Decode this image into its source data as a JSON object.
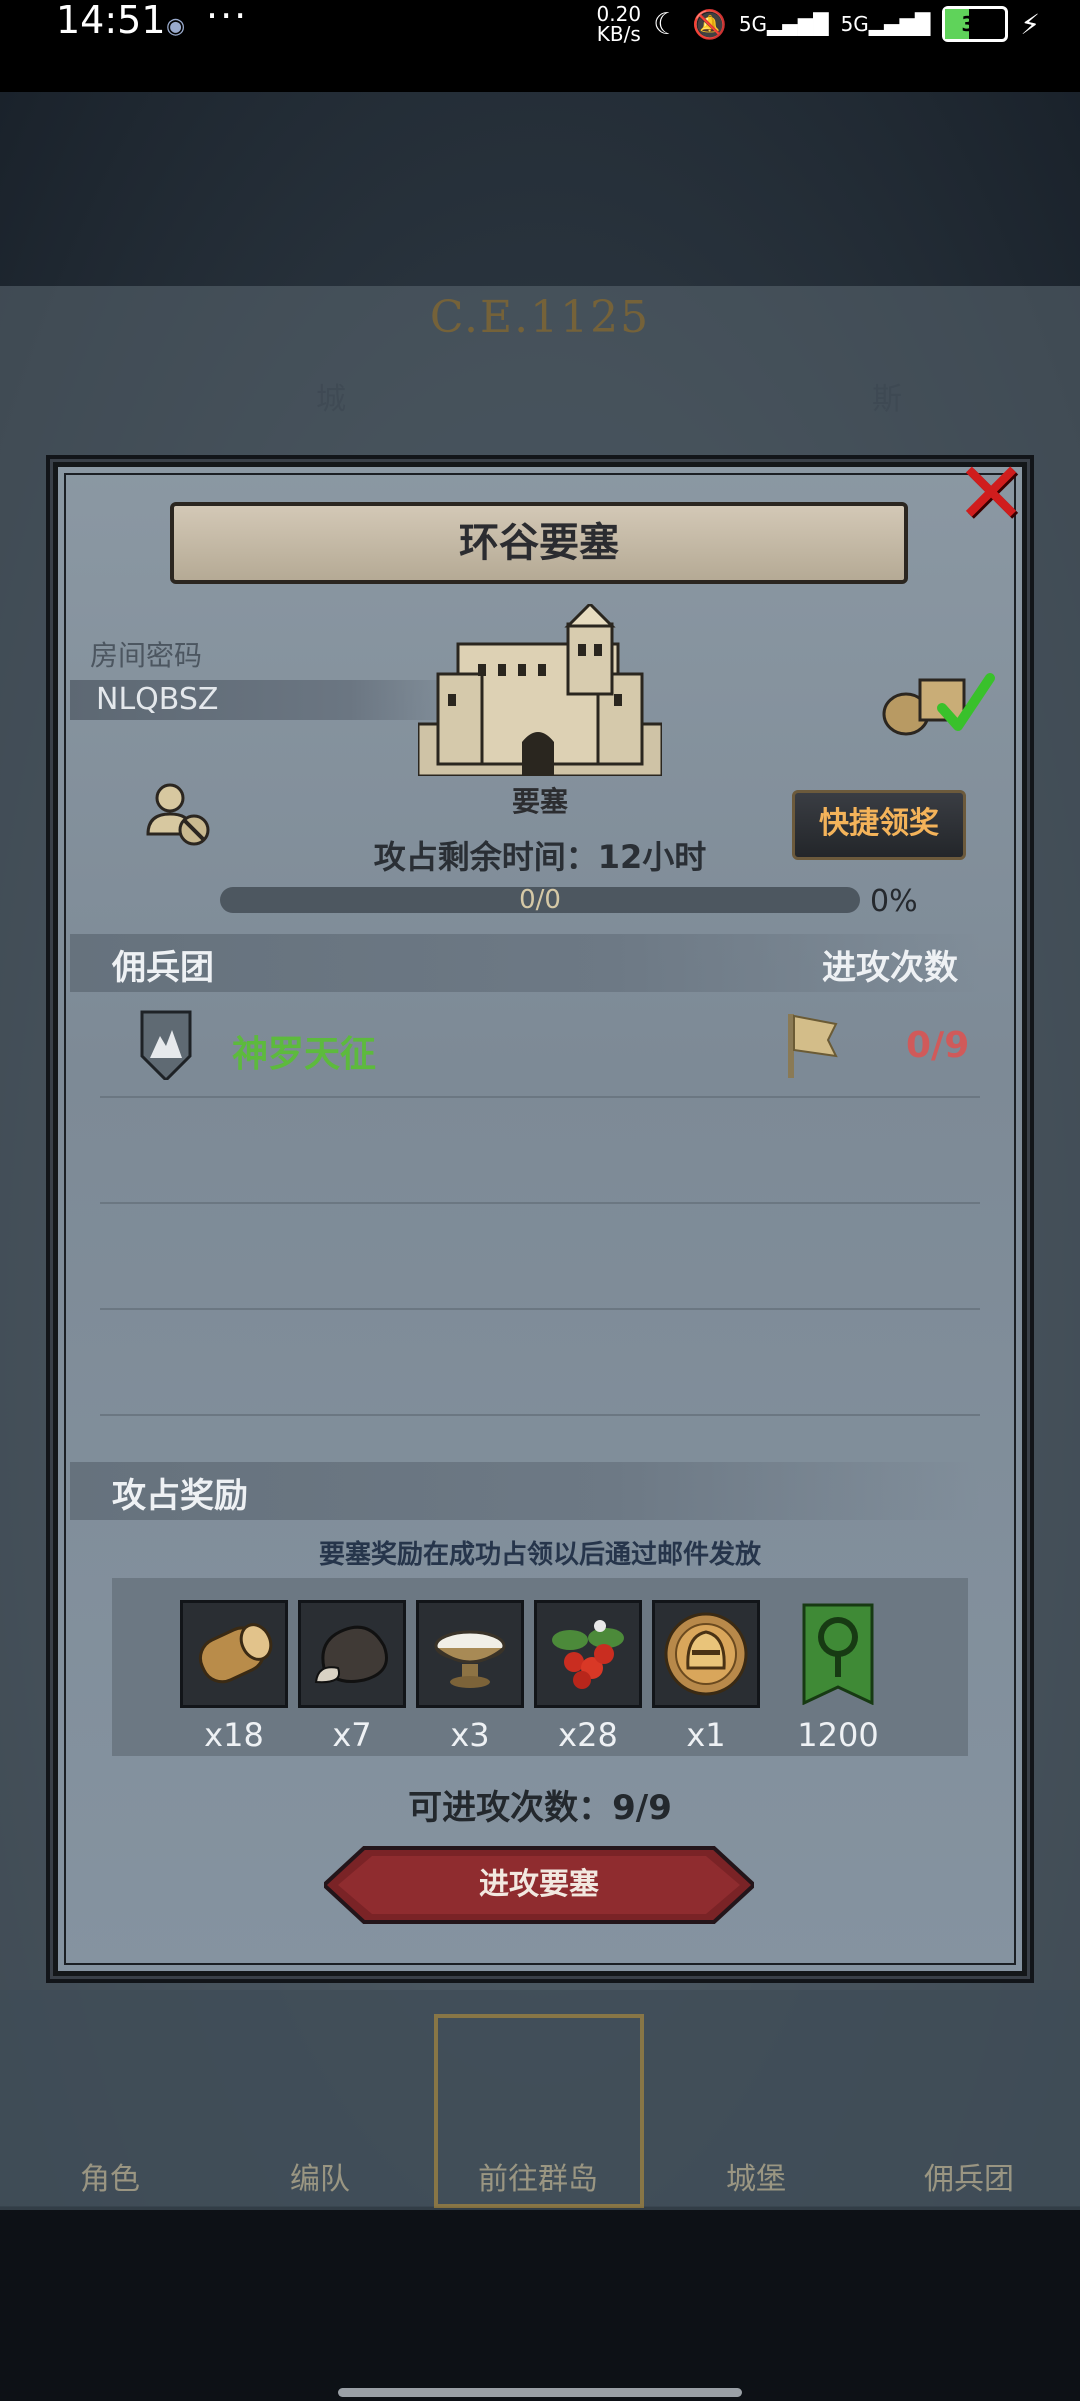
{
  "status_bar": {
    "time": "14:51",
    "network_speed_value": "0.20",
    "network_speed_unit": "KB/s",
    "battery": "39"
  },
  "background": {
    "year": "C.E.1125",
    "labels": [
      "城",
      "斯"
    ],
    "nav": [
      "角色",
      "编队",
      "前往群岛",
      "城堡",
      "佣兵团"
    ]
  },
  "modal": {
    "title": "环谷要塞",
    "room_password_label": "房间密码",
    "room_password": "NLQBSZ",
    "fort_type": "要塞",
    "remaining_time": "攻占剩余时间：12小时",
    "quick_claim": "快捷领奖",
    "progress_text": "0/0",
    "progress_percent": "0%",
    "progress_fraction": 0,
    "mercenary_header": "佣兵团",
    "attack_count_header": "进攻次数",
    "mercenaries": [
      {
        "name": "神罗天征",
        "attacks": "0/9"
      }
    ],
    "rewards_header": "攻占奖励",
    "rewards_note": "要塞奖励在成功占领以后通过邮件发放",
    "rewards": [
      {
        "icon": "wood-log-icon",
        "qty": "x18"
      },
      {
        "icon": "ore-rock-icon",
        "qty": "x7"
      },
      {
        "icon": "salt-bowl-icon",
        "qty": "x3"
      },
      {
        "icon": "berries-icon",
        "qty": "x28"
      },
      {
        "icon": "knight-helmet-medal-icon",
        "qty": "x1"
      },
      {
        "icon": "green-tree-banner-icon",
        "qty": "1200"
      }
    ],
    "attempts": "可进攻次数：9/9",
    "attack_button": "进攻要塞"
  },
  "colors": {
    "close": "#d01d1d",
    "merc_name": "#5dba3d",
    "attack_count": "#d05a5a",
    "quick_claim_text": "#f4b35a"
  }
}
